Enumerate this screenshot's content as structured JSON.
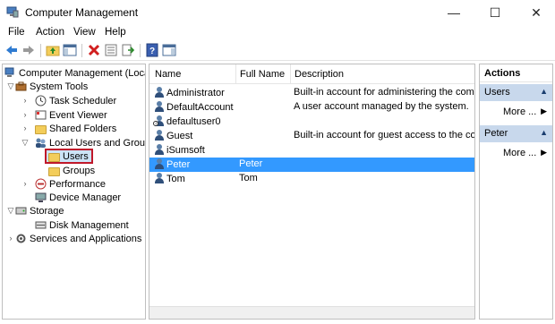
{
  "window": {
    "title": "Computer Management",
    "minimize_glyph": "—",
    "maximize_glyph": "☐",
    "close_glyph": "✕"
  },
  "menu": [
    "File",
    "Action",
    "View",
    "Help"
  ],
  "toolbar": {
    "icons": [
      "back-icon",
      "forward-icon",
      "up-folder-icon",
      "show-hide-tree-icon",
      "delete-icon",
      "properties-icon",
      "export-list-icon",
      "help-icon",
      "show-action-pane-icon"
    ]
  },
  "tree": {
    "root": "Computer Management (Local",
    "system_tools": "System Tools",
    "task_scheduler": "Task Scheduler",
    "event_viewer": "Event Viewer",
    "shared_folders": "Shared Folders",
    "local_users_groups": "Local Users and Groups",
    "users": "Users",
    "groups": "Groups",
    "performance": "Performance",
    "device_manager": "Device Manager",
    "storage": "Storage",
    "disk_management": "Disk Management",
    "services_apps": "Services and Applications"
  },
  "list": {
    "columns": [
      "Name",
      "Full Name",
      "Description"
    ],
    "rows": [
      {
        "name": "Administrator",
        "full_name": "",
        "description": "Built-in account for administering the compu",
        "disabled": false,
        "selected": false
      },
      {
        "name": "DefaultAccount",
        "full_name": "",
        "description": "A user account managed by the system.",
        "disabled": false,
        "selected": false
      },
      {
        "name": "defaultuser0",
        "full_name": "",
        "description": "",
        "disabled": true,
        "selected": false
      },
      {
        "name": "Guest",
        "full_name": "",
        "description": "Built-in account for guest access to the comp",
        "disabled": false,
        "selected": false
      },
      {
        "name": "iSumsoft",
        "full_name": "",
        "description": "",
        "disabled": false,
        "selected": false
      },
      {
        "name": "Peter",
        "full_name": "Peter",
        "description": "",
        "disabled": false,
        "selected": true
      },
      {
        "name": "Tom",
        "full_name": "Tom",
        "description": "",
        "disabled": false,
        "selected": false
      }
    ]
  },
  "actions": {
    "title": "Actions",
    "groups": [
      {
        "label": "Users",
        "more": "More ..."
      },
      {
        "label": "Peter",
        "more": "More ..."
      }
    ]
  },
  "colors": {
    "selection": "#3399ff",
    "users_highlight_border": "#c0182a",
    "action_group_bg": "#c8d8ec"
  }
}
